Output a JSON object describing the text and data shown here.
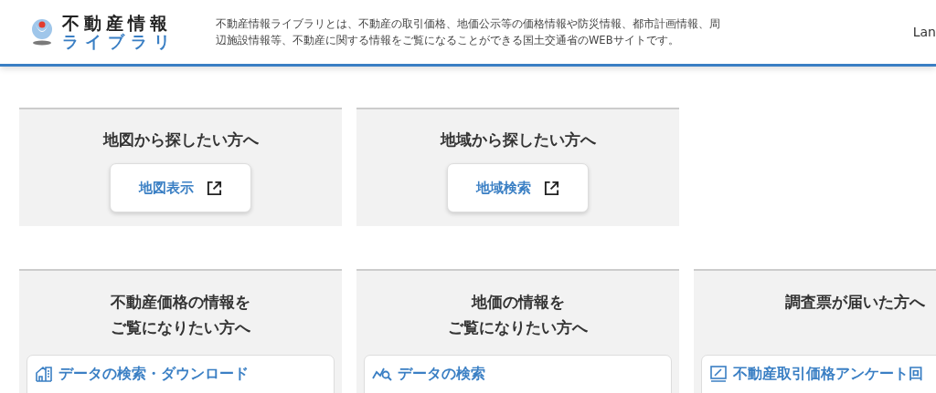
{
  "header": {
    "logo_title": "不動産情報",
    "logo_subtitle": "ライブラリ",
    "description": "不動産情報ライブラリとは、不動産の取引価格、地価公示等の価格情報や防災情報、都市計画情報、周辺施設情報等、不動産に関する情報をご覧になることができる国土交通省のWEBサイトです。",
    "language": "Lan"
  },
  "search_cards": [
    {
      "title": "地図から探したい方へ",
      "button": {
        "label": "地図表示"
      }
    },
    {
      "title": "地域から探したい方へ",
      "button": {
        "label": "地域検索"
      }
    }
  ],
  "info_cards": [
    {
      "title_lines": [
        "不動産価格の情報を",
        "ご覧になりたい方へ"
      ],
      "link": {
        "label": "データの検索・ダウンロード",
        "kind": "download"
      }
    },
    {
      "title_lines": [
        "地価の情報を",
        "ご覧になりたい方へ"
      ],
      "link": {
        "label": "データの検索",
        "kind": "search"
      }
    },
    {
      "title_lines": [
        "調査票が届いた方へ"
      ],
      "link": {
        "label": "不動産取引価格アンケート回",
        "kind": "survey"
      }
    }
  ]
}
